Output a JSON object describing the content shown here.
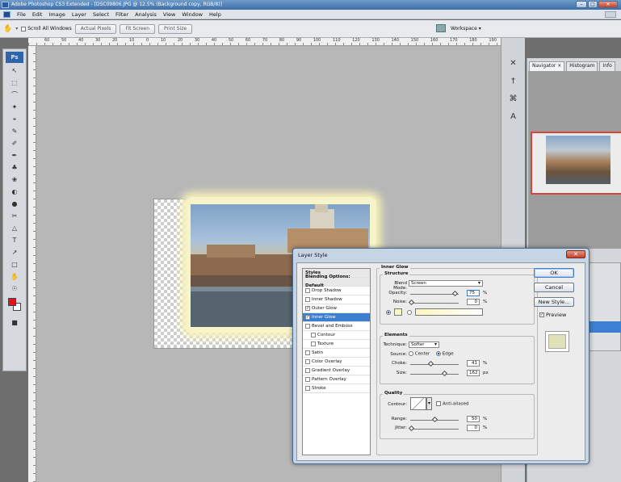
{
  "window": {
    "title": "Adobe Photoshop CS3 Extended - [DSC09806.JPG @ 12.5% (Background copy, RGB/8)]"
  },
  "menubar": [
    "File",
    "Edit",
    "Image",
    "Layer",
    "Select",
    "Filter",
    "Analysis",
    "View",
    "Window",
    "Help"
  ],
  "options_bar": {
    "scroll_all_windows": "Scroll All Windows",
    "actual_pixels": "Actual Pixels",
    "fit_screen": "Fit Screen",
    "print_size": "Print Size",
    "workspace": "Workspace ▾"
  },
  "ruler_labels": [
    "60",
    "50",
    "40",
    "30",
    "20",
    "10",
    "0",
    "10",
    "20",
    "30",
    "40",
    "50",
    "60",
    "70",
    "80",
    "90",
    "100",
    "110",
    "120",
    "130",
    "140",
    "150",
    "160",
    "170",
    "180",
    "190"
  ],
  "toolbox": {
    "logo": "Ps",
    "tools": [
      "↖",
      "⬚",
      "⌒",
      "✦",
      "⌖",
      "✎",
      "✐",
      "✒",
      "♣",
      "❀",
      "◐",
      "●",
      "✂",
      "△",
      "T",
      "↗",
      "□",
      "✋",
      "☉",
      "■"
    ],
    "fg_color": "#e0141e",
    "bg_color": "#ffffff"
  },
  "panels": {
    "tabs": [
      "Navigator ×",
      "Histogram",
      "Info"
    ],
    "dock_icons": [
      "✕",
      "†",
      "⌘",
      "A"
    ]
  },
  "dialog": {
    "title": "Layer Style",
    "close": "✕",
    "styles_list": [
      {
        "label": "Styles",
        "kind": "hdr",
        "checked": false
      },
      {
        "label": "Blending Options: Default",
        "kind": "hdr",
        "checked": false
      },
      {
        "label": "Drop Shadow",
        "kind": "item",
        "checked": false
      },
      {
        "label": "Inner Shadow",
        "kind": "item",
        "checked": false
      },
      {
        "label": "Outer Glow",
        "kind": "item",
        "checked": true
      },
      {
        "label": "Inner Glow",
        "kind": "sel",
        "checked": true
      },
      {
        "label": "Bevel and Emboss",
        "kind": "item",
        "checked": false
      },
      {
        "label": "Contour",
        "kind": "indent",
        "checked": false
      },
      {
        "label": "Texture",
        "kind": "indent",
        "checked": false
      },
      {
        "label": "Satin",
        "kind": "item",
        "checked": false
      },
      {
        "label": "Color Overlay",
        "kind": "item",
        "checked": false
      },
      {
        "label": "Gradient Overlay",
        "kind": "item",
        "checked": false
      },
      {
        "label": "Pattern Overlay",
        "kind": "item",
        "checked": false
      },
      {
        "label": "Stroke",
        "kind": "item",
        "checked": false
      }
    ],
    "inner_glow": {
      "heading": "Inner Glow",
      "structure": "Structure",
      "blend_mode_label": "Blend Mode:",
      "blend_mode": "Screen",
      "opacity_label": "Opacity:",
      "opacity": "75",
      "noise_label": "Noise:",
      "noise": "0",
      "percent": "%",
      "elements": "Elements",
      "technique_label": "Technique:",
      "technique": "Softer",
      "source_label": "Source:",
      "source_center": "Center",
      "source_edge": "Edge",
      "choke_label": "Choke:",
      "choke": "41",
      "size_label": "Size:",
      "size": "162",
      "px": "px",
      "quality": "Quality",
      "contour_label": "Contour:",
      "anti_aliased": "Anti-aliased",
      "range_label": "Range:",
      "range": "50",
      "jitter_label": "Jitter:",
      "jitter": "0",
      "glow_color": "#fbf7c0"
    },
    "buttons": {
      "ok": "OK",
      "cancel": "Cancel",
      "new_style": "New Style...",
      "preview": "Preview"
    }
  }
}
